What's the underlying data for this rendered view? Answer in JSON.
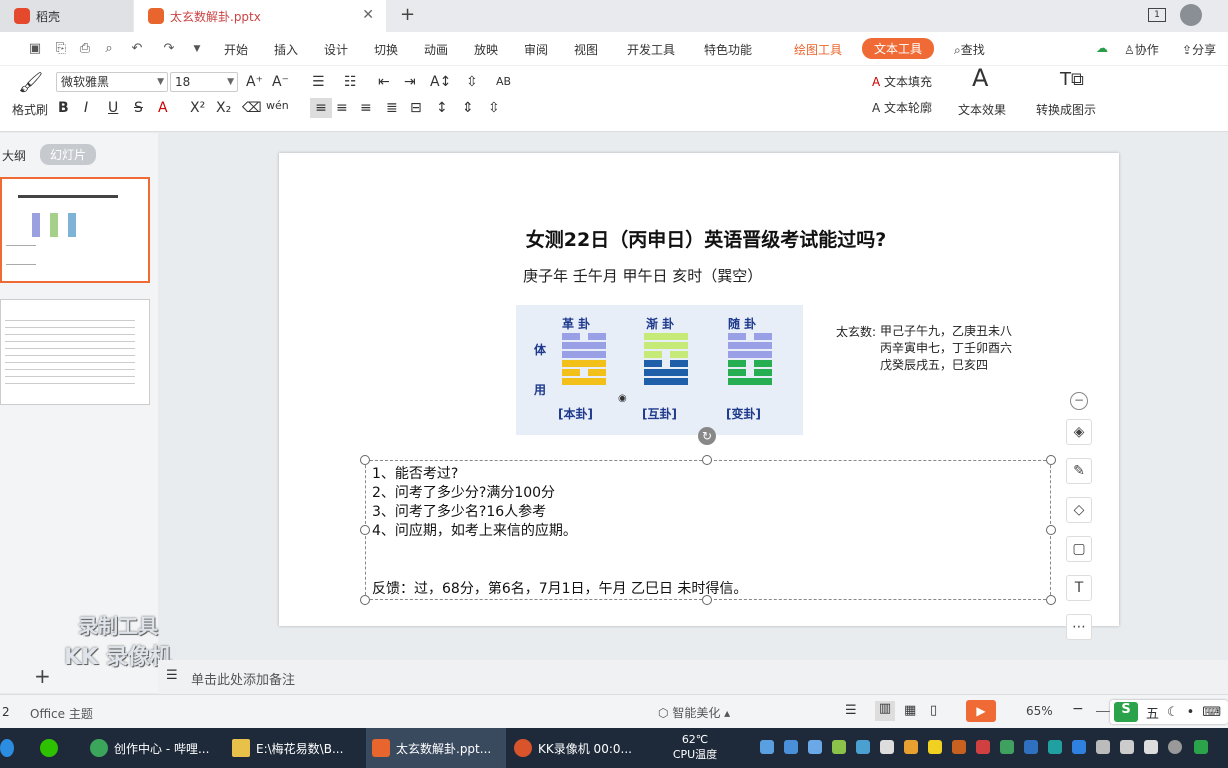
{
  "tabs": {
    "home": "稻壳",
    "doc": "太玄数解卦.pptx",
    "add": "+"
  },
  "menu": [
    "开始",
    "插入",
    "设计",
    "切换",
    "动画",
    "放映",
    "审阅",
    "视图",
    "开发工具",
    "特色功能",
    "绘图工具",
    "文本工具"
  ],
  "menu_right": {
    "search": "查找",
    "collab": "协作",
    "share": "分享"
  },
  "ribbon": {
    "format_painter": "格式刷",
    "font_name": "微软雅黑",
    "font_size": "18",
    "text_fill": "文本填充",
    "text_outline": "文本轮廓",
    "text_effect": "文本效果",
    "convert": "转换成图示",
    "gallery_colors": [
      "#111111",
      "#5b9bd5",
      "#ed7d31",
      "#8fa9d8",
      "#ffc000",
      "#7f7f7f"
    ]
  },
  "left_panel": {
    "outline": "大纲",
    "slides": "幻灯片",
    "slide_num": "2"
  },
  "slide": {
    "title": "女测22日（丙申日）英语晋级考试能过吗?",
    "subtitle": "庚子年 壬午月 甲午日 亥时（巽空）",
    "taixuan_label": "太玄数:",
    "taixuan_lines": [
      "甲己子午九，乙庚丑未八",
      "丙辛寅申七，丁壬卯酉六",
      "戊癸辰戌五，巳亥四"
    ],
    "gua_names": [
      "革 卦",
      "渐 卦",
      "随 卦"
    ],
    "gua_labels": [
      "[本卦]",
      "[互卦]",
      "[变卦]"
    ],
    "ti": "体",
    "yong": "用",
    "textbox": {
      "items": [
        "1、能否考过?",
        "2、问考了多少分?满分100分",
        "3、问考了多少名?16人参考",
        "4、问应期，如考上来信的应期。"
      ],
      "feedback": "反馈：过，68分，第6名，7月1日，午月 乙巳日 未时得信。"
    }
  },
  "notes_placeholder": "单击此处添加备注",
  "status": {
    "page": "2",
    "theme": "Office 主题",
    "beautify": "智能美化",
    "zoom": "65%"
  },
  "watermark": {
    "line1": "录制工具",
    "line2": "KK 录像机"
  },
  "taskbar": {
    "items": [
      "创作中心 - 哔哩...",
      "E:\\梅花易数\\B...",
      "太玄数解卦.ppt...",
      "KK录像机 00:0..."
    ],
    "temp": "62℃",
    "cpu": "CPU温度",
    "ime": "五"
  }
}
